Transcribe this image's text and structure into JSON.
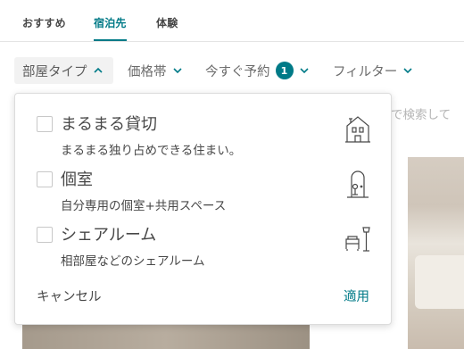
{
  "tabs": [
    {
      "label": "おすすめ",
      "active": false
    },
    {
      "label": "宿泊先",
      "active": true
    },
    {
      "label": "体験",
      "active": false
    }
  ],
  "filters": {
    "room_type": {
      "label": "部屋タイプ",
      "expanded": true
    },
    "price": {
      "label": "価格帯"
    },
    "instant_book": {
      "label": "今すぐ予約",
      "badge": "1"
    },
    "more": {
      "label": "フィルター"
    }
  },
  "background": {
    "search_hint": "で検索して"
  },
  "room_type_panel": {
    "options": [
      {
        "title": "まるまる貸切",
        "description": "まるまる独り占めできる住まい。",
        "checked": false,
        "icon": "house-icon"
      },
      {
        "title": "個室",
        "description": "自分専用の個室+共用スペース",
        "checked": false,
        "icon": "door-icon"
      },
      {
        "title": "シェアルーム",
        "description": "相部屋などのシェアルーム",
        "checked": false,
        "icon": "couch-lamp-icon"
      }
    ],
    "cancel_label": "キャンセル",
    "apply_label": "適用"
  },
  "colors": {
    "accent": "#007a87",
    "text": "#484848",
    "muted": "#6b6b6b"
  }
}
